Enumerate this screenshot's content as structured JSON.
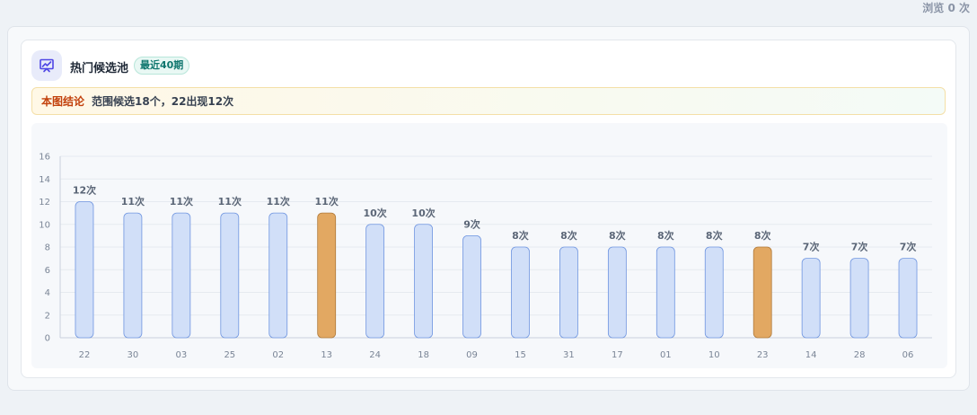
{
  "header": {
    "views": "浏览 0 次"
  },
  "card": {
    "title": "热门候选池",
    "badge": "最近40期",
    "conclusion_label": "本图结论",
    "conclusion_text": "范围候选18个，22出现12次"
  },
  "colors": {
    "bar": "#d1dff8",
    "bar_border": "#6f95e0",
    "highlight": "#e2a862",
    "highlight_border": "#b07a3a",
    "accent_icon": "#4f46e5"
  },
  "icons": {
    "header": "presentation-chart-icon"
  },
  "chart_data": {
    "type": "bar",
    "categories": [
      "22",
      "30",
      "03",
      "25",
      "02",
      "13",
      "24",
      "18",
      "09",
      "15",
      "31",
      "17",
      "01",
      "10",
      "23",
      "14",
      "28",
      "06"
    ],
    "values": [
      12,
      11,
      11,
      11,
      11,
      11,
      10,
      10,
      9,
      8,
      8,
      8,
      8,
      8,
      8,
      7,
      7,
      7
    ],
    "value_labels": [
      "12次",
      "11次",
      "11次",
      "11次",
      "11次",
      "11次",
      "10次",
      "10次",
      "9次",
      "8次",
      "8次",
      "8次",
      "8次",
      "8次",
      "8次",
      "7次",
      "7次",
      "7次"
    ],
    "highlighted": [
      "13",
      "23"
    ],
    "yticks": [
      "0",
      "2",
      "4",
      "6",
      "8",
      "10",
      "12",
      "14",
      "16"
    ],
    "ylim": [
      0,
      16
    ],
    "grid": true,
    "title": "",
    "xlabel": "",
    "ylabel": ""
  }
}
